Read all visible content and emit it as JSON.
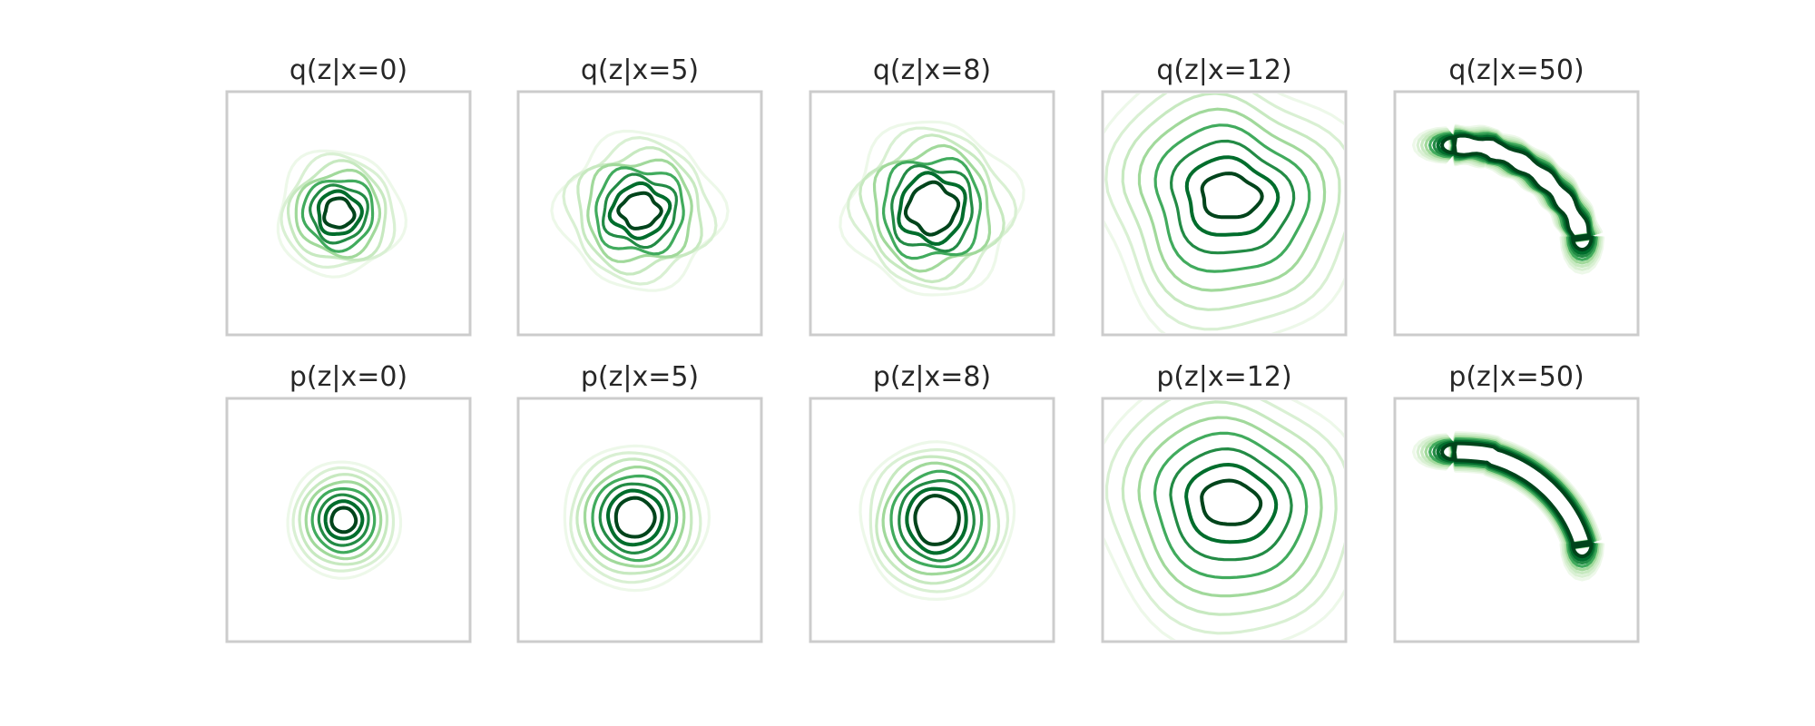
{
  "chart_data": [
    {
      "type": "contour",
      "title": "q(z|x=0)"
    },
    {
      "type": "contour",
      "title": "q(z|x=5)"
    },
    {
      "type": "contour",
      "title": "q(z|x=8)"
    },
    {
      "type": "contour",
      "title": "q(z|x=12)"
    },
    {
      "type": "contour",
      "title": "q(z|x=50)"
    },
    {
      "type": "contour",
      "title": "p(z|x=0)"
    },
    {
      "type": "contour",
      "title": "p(z|x=5)"
    },
    {
      "type": "contour",
      "title": "p(z|x=8)"
    },
    {
      "type": "contour",
      "title": "p(z|x=12)"
    },
    {
      "type": "contour",
      "title": "p(z|x=50)"
    }
  ],
  "style": {
    "colormap": "Greens",
    "frame_color": "#cccccc",
    "axis_ticks": false,
    "grid": false,
    "layout": "2 rows x 5 columns"
  }
}
